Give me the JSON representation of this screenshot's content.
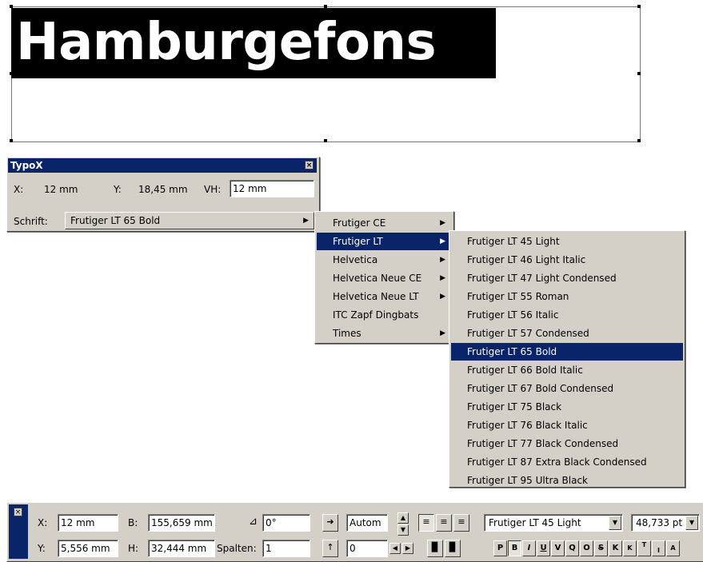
{
  "sample": {
    "text": "Hamburgefons"
  },
  "typox": {
    "title": "TypoX",
    "close": "×",
    "x_label": "X:",
    "x_value": "12 mm",
    "y_label": "Y:",
    "y_value": "18,45 mm",
    "vh_label": "VH:",
    "vh_value": "12 mm",
    "font_label": "Schrift:",
    "font_value": "Frutiger LT 65 Bold"
  },
  "font_families": {
    "items": [
      {
        "label": "Frutiger CE",
        "submenu": true
      },
      {
        "label": "Frutiger LT",
        "submenu": true,
        "selected": true
      },
      {
        "label": "Helvetica",
        "submenu": true
      },
      {
        "label": "Helvetica Neue CE",
        "submenu": true
      },
      {
        "label": "Helvetica Neue LT",
        "submenu": true
      },
      {
        "label": "ITC Zapf Dingbats",
        "submenu": false
      },
      {
        "label": "Times",
        "submenu": true
      }
    ]
  },
  "font_styles": {
    "items": [
      {
        "label": "Frutiger LT 45 Light"
      },
      {
        "label": "Frutiger LT 46 Light Italic"
      },
      {
        "label": "Frutiger LT 47 Light Condensed"
      },
      {
        "label": "Frutiger LT 55 Roman"
      },
      {
        "label": "Frutiger LT 56 Italic"
      },
      {
        "label": "Frutiger LT 57 Condensed"
      },
      {
        "label": "Frutiger LT 65 Bold",
        "selected": true
      },
      {
        "label": "Frutiger LT 66 Bold Italic"
      },
      {
        "label": "Frutiger LT 67 Bold Condensed"
      },
      {
        "label": "Frutiger LT 75 Black"
      },
      {
        "label": "Frutiger LT 76 Black Italic"
      },
      {
        "label": "Frutiger LT 77 Black Condensed"
      },
      {
        "label": "Frutiger LT 87 Extra Black Condensed"
      },
      {
        "label": "Frutiger LT 95 Ultra Black"
      }
    ]
  },
  "toolbar": {
    "close": "×",
    "x_label": "X:",
    "x_value": "12 mm",
    "y_label": "Y:",
    "y_value": "5,556 mm",
    "b_label": "B:",
    "b_value": "155,659 mm",
    "h_label": "H:",
    "h_value": "32,444 mm",
    "angle_value": "0°",
    "spalten_label": "Spalten:",
    "spalten_value": "1",
    "auto_value": "Autom",
    "spacing_value": "0",
    "font_value": "Frutiger LT 45 Light",
    "size_value": "48,733 pt",
    "format_buttons": [
      "P",
      "B",
      "I",
      "U",
      "V",
      "Q",
      "O",
      "S",
      "K",
      "K",
      "T",
      "I",
      "A"
    ]
  },
  "colors": {
    "selection": "#0a246a",
    "panel": "#d4d0c8"
  }
}
